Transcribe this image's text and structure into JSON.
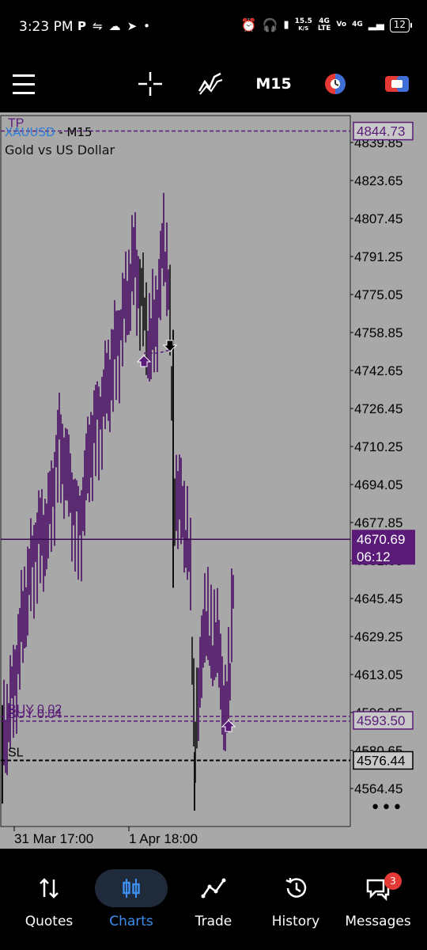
{
  "status_bar": {
    "time": "3:23 PM",
    "net_speed_value": "15.5",
    "net_speed_unit": "K/S",
    "sim1_top": "4G",
    "sim1_bottom": "LTE",
    "sim1_vo": "Vo",
    "sim2_top": "4G",
    "battery": "12"
  },
  "toolbar": {
    "timeframe": "M15"
  },
  "chart": {
    "symbol": "XAUUSD",
    "symbol_sep": " - ",
    "timeframe": "M15",
    "description": "Gold vs US Dollar",
    "price_labels": [
      "4839.85",
      "4823.65",
      "4807.45",
      "4791.25",
      "4775.05",
      "4758.85",
      "4742.65",
      "4726.45",
      "4710.25",
      "4694.05",
      "4677.85",
      "4661.65",
      "4645.45",
      "4629.25",
      "4613.05",
      "4596.85",
      "4580.65",
      "4564.45"
    ],
    "time_labels": [
      "31 Mar 17:00",
      "1 Apr 18:00"
    ],
    "tp_label": "TP",
    "tp_price": "4844.73",
    "current_price": "4670.69",
    "countdown": "06:12",
    "buy_label_1": "BUY 0.02",
    "buy_label_2": "BUY 0.04",
    "buy_price": "4593.50",
    "sl_label": "SL",
    "sl_price": "4576.44",
    "colors": {
      "background": "#a8a8a8",
      "candles": "#4a0d66",
      "candle_dark": "#111111",
      "tp_line": "#5a1a78",
      "current_line": "#3a0a52",
      "label_bg": "#5a1a78",
      "sl_line": "#000000"
    }
  },
  "bottom_nav": {
    "items": [
      {
        "label": "Quotes",
        "icon": "arrows-updown-icon"
      },
      {
        "label": "Charts",
        "icon": "candlestick-icon"
      },
      {
        "label": "Trade",
        "icon": "trend-icon"
      },
      {
        "label": "History",
        "icon": "history-icon"
      },
      {
        "label": "Messages",
        "icon": "messages-icon"
      }
    ],
    "messages_badge": "3"
  }
}
